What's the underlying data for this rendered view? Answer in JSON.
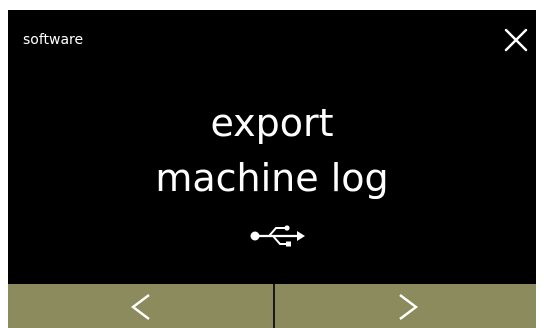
{
  "header": {
    "title": "software",
    "close_icon": "close-icon"
  },
  "main": {
    "title_line1": "export",
    "title_line2": "machine log",
    "icon": "usb-icon"
  },
  "nav": {
    "prev_icon": "chevron-left-icon",
    "next_icon": "chevron-right-icon"
  },
  "colors": {
    "background": "#000000",
    "text": "#ffffff",
    "nav_bar": "#8b8b5e"
  }
}
